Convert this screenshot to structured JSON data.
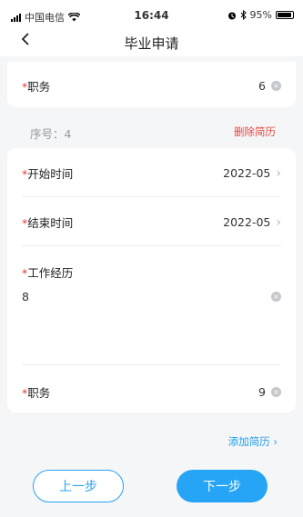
{
  "status_bar": {
    "carrier": "中国电信",
    "time": "16:44",
    "battery": "95%",
    "battery_level": 0.95,
    "icons": [
      "signal-icon",
      "wifi-icon",
      "alarm-icon",
      "bluetooth-icon",
      "battery-icon"
    ]
  },
  "nav": {
    "back_icon": "chevron-left-icon",
    "title": "毕业申请"
  },
  "resume1": {
    "position_label": "职务",
    "position_value": "6",
    "required_mark": "*"
  },
  "resume2": {
    "seq_label": "序号：4",
    "delete_label": "删除简历",
    "start_label": "开始时间",
    "start_value": "2022-05",
    "end_label": "结束时间",
    "end_value": "2022-05",
    "experience_label": "工作经历",
    "experience_value": "8",
    "position_label": "职务",
    "position_value": "9",
    "required_mark": "*"
  },
  "add_resume_label": "添加简历",
  "buttons": {
    "prev": "上一步",
    "next": "下一步"
  },
  "colors": {
    "accent": "#26a4f5",
    "danger": "#e8453c",
    "required": "#e53935",
    "background": "#f5f6f8"
  }
}
